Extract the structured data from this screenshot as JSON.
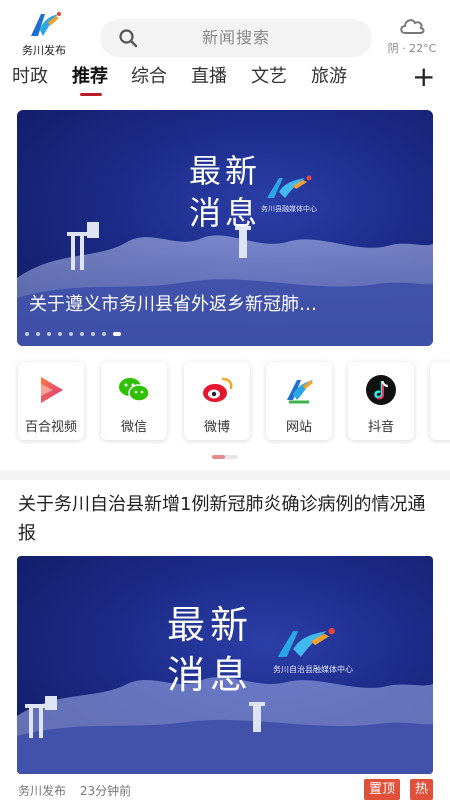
{
  "header": {
    "logo_text": "务川发布",
    "search_placeholder": "新闻搜索",
    "weather_text": "阴 · 22°C"
  },
  "tabs": [
    "时政",
    "推荐",
    "综合",
    "直播",
    "文艺",
    "旅游"
  ],
  "active_tab": "推荐",
  "banner": {
    "headline_line1": "最新",
    "headline_line2": "消息",
    "org": "务川县融媒体中心",
    "title": "关于遵义市务川县省外返乡新冠肺…",
    "slide_count": 9,
    "active_slide": 9
  },
  "shortcuts": [
    {
      "label": "百合视频",
      "icon": "baihe-video-icon"
    },
    {
      "label": "微信",
      "icon": "wechat-icon"
    },
    {
      "label": "微博",
      "icon": "weibo-icon"
    },
    {
      "label": "网站",
      "icon": "website-icon"
    },
    {
      "label": "抖音",
      "icon": "douyin-icon"
    }
  ],
  "article": {
    "title": "关于务川自治县新增1例新冠肺炎确诊病例的情况通报",
    "image_headline_line1": "最新",
    "image_headline_line2": "消息",
    "image_org": "务川自治县融媒体中心",
    "source": "务川发布",
    "time": "23分钟前",
    "badges": [
      "置顶",
      "热"
    ]
  },
  "colors": {
    "accent": "#b81d2a",
    "badge": "#e0503a",
    "banner_blue": "#1b2a86"
  }
}
